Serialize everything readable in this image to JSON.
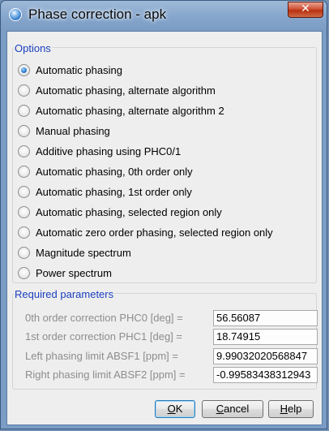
{
  "window": {
    "title": "Phase correction - apk",
    "close_glyph": "✕"
  },
  "options": {
    "legend": "Options",
    "selected_index": 0,
    "items": [
      {
        "label": "Automatic phasing"
      },
      {
        "label": "Automatic phasing, alternate algorithm"
      },
      {
        "label": "Automatic phasing, alternate algorithm 2"
      },
      {
        "label": "Manual phasing"
      },
      {
        "label": "Additive phasing using PHC0/1"
      },
      {
        "label": "Automatic phasing, 0th order only"
      },
      {
        "label": "Automatic phasing, 1st order only"
      },
      {
        "label": "Automatic phasing, selected region only"
      },
      {
        "label": "Automatic zero order phasing, selected region only"
      },
      {
        "label": "Magnitude spectrum"
      },
      {
        "label": "Power spectrum"
      }
    ]
  },
  "parameters": {
    "legend": "Required parameters",
    "rows": [
      {
        "label": "0th order correction PHC0 [deg] =",
        "value": "56.56087"
      },
      {
        "label": "1st order correction PHC1 [deg] =",
        "value": "18.74915"
      },
      {
        "label": "Left phasing limit ABSF1 [ppm] =",
        "value": "9.99032020568847"
      },
      {
        "label": "Right phasing limit ABSF2 [ppm] =",
        "value": "-0.99583438312943"
      }
    ]
  },
  "buttons": {
    "ok": {
      "mnemonic": "O",
      "rest": "K"
    },
    "cancel": {
      "mnemonic": "C",
      "rest": "ancel"
    },
    "help": {
      "mnemonic": "H",
      "rest": "elp"
    }
  }
}
